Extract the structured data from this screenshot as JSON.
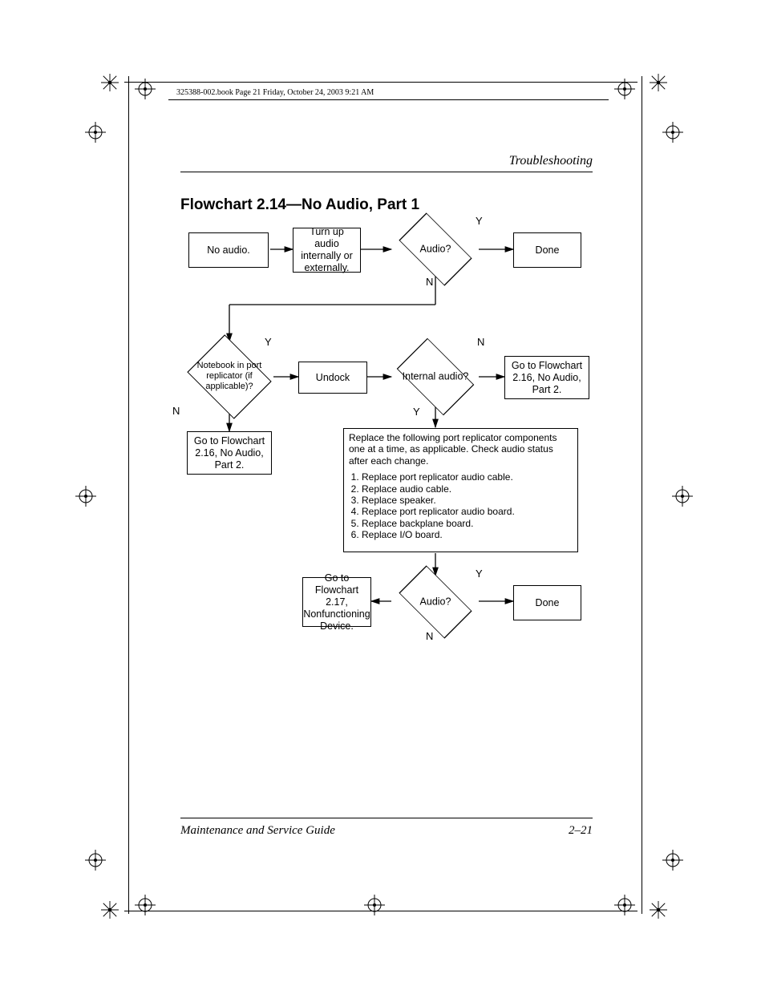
{
  "print_line": "325388-002.book  Page 21  Friday, October 24, 2003  9:21 AM",
  "chapter": "Troubleshooting",
  "title": "Flowchart 2.14—No Audio, Part 1",
  "nodes": {
    "no_audio": "No audio.",
    "turn_up": "Turn up audio internally or externally.",
    "audio1": "Audio?",
    "done1": "Done",
    "port_rep": "Notebook in port replicator (if applicable)?",
    "undock": "Undock",
    "internal_audio": "Internal audio?",
    "goto_216_a": "Go to Flowchart 2.16, No Audio, Part 2.",
    "goto_216_b": "Go to Flowchart 2.16, No Audio, Part 2.",
    "replace_intro": "Replace the following port replicator components one at a time, as applicable. Check audio status after each change.",
    "replace_steps": [
      "Replace port replicator audio cable.",
      "Replace audio cable.",
      "Replace speaker.",
      "Replace port replicator audio board.",
      "Replace backplane board.",
      "Replace I/O board."
    ],
    "goto_217": "Go to Flowchart 2.17, Nonfunctioning Device.",
    "audio2": "Audio?",
    "done2": "Done"
  },
  "labels": {
    "Y": "Y",
    "N": "N"
  },
  "footer": {
    "left": "Maintenance and Service Guide",
    "right": "2–21"
  }
}
